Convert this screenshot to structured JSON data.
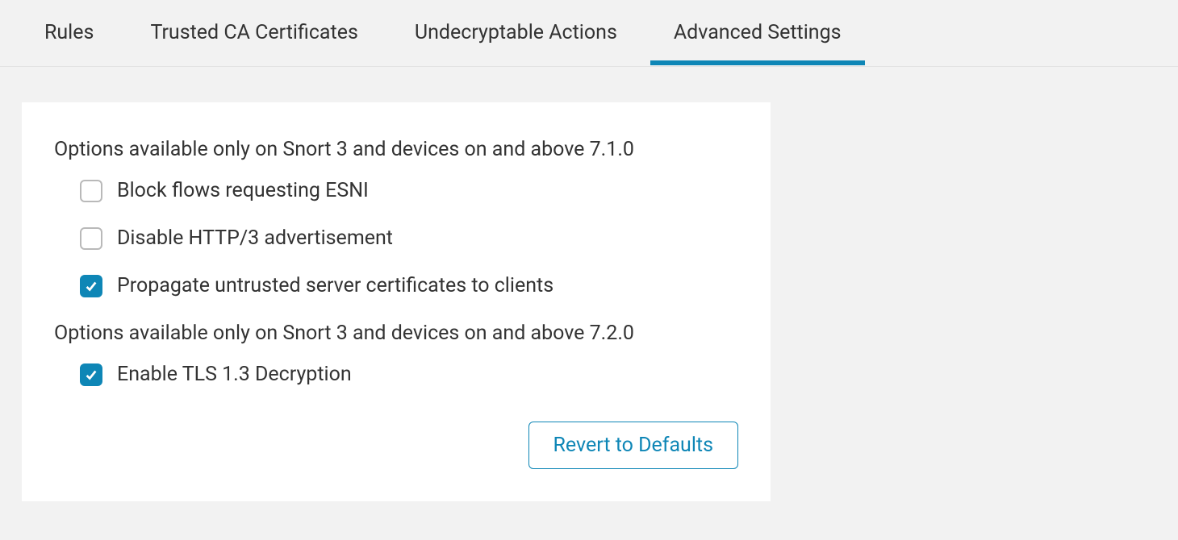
{
  "tabs": [
    {
      "label": "Rules",
      "active": false
    },
    {
      "label": "Trusted CA Certificates",
      "active": false
    },
    {
      "label": "Undecryptable Actions",
      "active": false
    },
    {
      "label": "Advanced Settings",
      "active": true
    }
  ],
  "section1_heading": "Options available only on Snort 3 and devices on and above 7.1.0",
  "section2_heading": "Options available only on Snort 3 and devices on and above 7.2.0",
  "options1": [
    {
      "label": "Block flows requesting ESNI",
      "checked": false
    },
    {
      "label": "Disable HTTP/3 advertisement",
      "checked": false
    },
    {
      "label": "Propagate untrusted server certificates to clients",
      "checked": true
    }
  ],
  "options2": [
    {
      "label": "Enable TLS 1.3 Decryption",
      "checked": true
    }
  ],
  "revert_label": "Revert to Defaults"
}
